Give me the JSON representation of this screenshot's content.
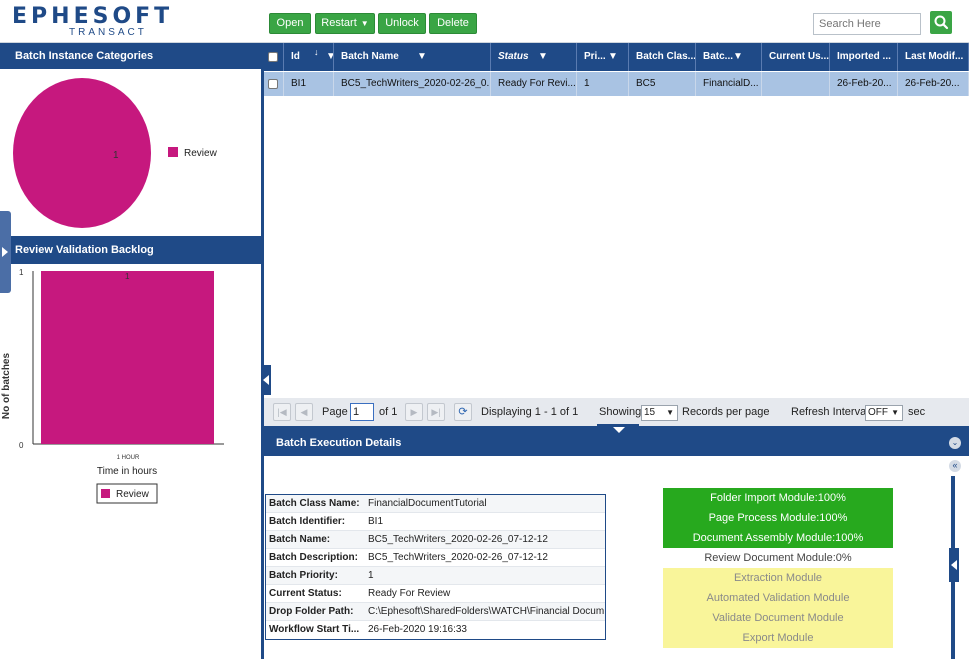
{
  "header": {
    "logo_main": "EPHESOFT",
    "logo_sub": "TRANSACT",
    "buttons": {
      "open": "Open",
      "restart": "Restart",
      "unlock": "Unlock",
      "delete": "Delete"
    },
    "search_placeholder": "Search Here"
  },
  "left": {
    "categories_title": "Batch Instance Categories",
    "backlog_title": "Review Validation Backlog",
    "pie_chart": {
      "type": "pie",
      "labels": [
        "Review"
      ],
      "values": [
        1
      ],
      "data_label": "1",
      "colors": [
        "#c6187e"
      ],
      "legend_label": "Review"
    },
    "bar_chart": {
      "type": "bar",
      "categories": [
        "1 HOUR"
      ],
      "values": [
        1
      ],
      "data_label": "1",
      "ylabel": "No of batches",
      "xlabel": "Time in hours",
      "y_ticks": [
        "0",
        "1"
      ],
      "ylim": [
        0,
        1
      ],
      "legend_label": "Review",
      "color": "#c6187e"
    }
  },
  "grid": {
    "columns": [
      "Id",
      "Batch Name",
      "Status",
      "Pri...",
      "Batch Clas...",
      "Batc...",
      "Current Us...",
      "Imported ...",
      "Last Modif..."
    ],
    "row": [
      "BI1",
      "BC5_TechWriters_2020-02-26_0...",
      "Ready For Revi...",
      "1",
      "BC5",
      "FinancialD...",
      "",
      "26-Feb-20...",
      "26-Feb-20..."
    ]
  },
  "pager": {
    "page_label": "Page",
    "page_value": "1",
    "of_label": "of 1",
    "displaying": "Displaying 1 - 1 of 1",
    "showing_label": "Showing",
    "showing_value": "15",
    "records_label": "Records per page",
    "refresh_label": "Refresh Interval",
    "refresh_value": "OFF",
    "sec_label": "sec"
  },
  "details": {
    "title": "Batch Execution Details",
    "rows": [
      {
        "k": "Batch Class Name:",
        "v": "FinancialDocumentTutorial"
      },
      {
        "k": "Batch Identifier:",
        "v": "BI1"
      },
      {
        "k": "Batch Name:",
        "v": "BC5_TechWriters_2020-02-26_07-12-12"
      },
      {
        "k": "Batch Description:",
        "v": "BC5_TechWriters_2020-02-26_07-12-12"
      },
      {
        "k": "Batch Priority:",
        "v": "1"
      },
      {
        "k": "Current Status:",
        "v": "Ready For Review"
      },
      {
        "k": "Drop Folder Path:",
        "v": "C:\\Ephesoft\\SharedFolders\\WATCH\\Financial Docum..."
      },
      {
        "k": "Workflow Start Ti...",
        "v": "26-Feb-2020 19:16:33"
      }
    ],
    "modules": [
      {
        "label": "Folder Import Module:100%",
        "state": "done"
      },
      {
        "label": "Page Process Module:100%",
        "state": "done"
      },
      {
        "label": "Document Assembly Module:100%",
        "state": "done"
      },
      {
        "label": "Review Document Module:0%",
        "state": "cur"
      },
      {
        "label": "Extraction Module",
        "state": "pend"
      },
      {
        "label": "Automated Validation Module",
        "state": "pend"
      },
      {
        "label": "Validate Document Module",
        "state": "pend"
      },
      {
        "label": "Export Module",
        "state": "pend"
      }
    ]
  }
}
